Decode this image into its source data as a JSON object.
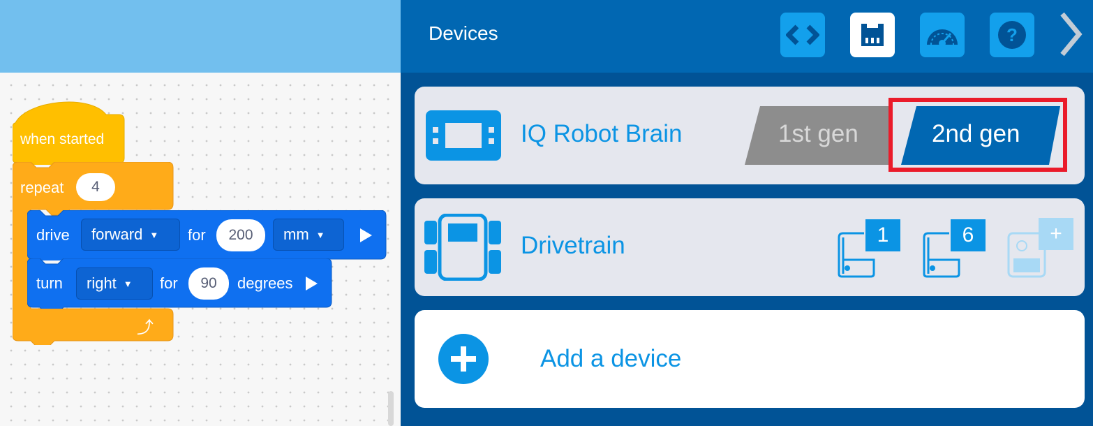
{
  "blocks": {
    "hat_label": "when started",
    "repeat_label": "repeat",
    "repeat_count": "4",
    "drive": {
      "label": "drive",
      "direction": "forward",
      "for_label": "for",
      "distance": "200",
      "unit": "mm"
    },
    "turn": {
      "label": "turn",
      "direction": "right",
      "for_label": "for",
      "angle": "90",
      "unit_label": "degrees"
    }
  },
  "panel": {
    "title": "Devices",
    "header_buttons": [
      "code-view-icon",
      "devices-icon",
      "dashboard-icon",
      "help-icon"
    ],
    "devices": [
      {
        "name": "IQ Robot Brain",
        "options": [
          "1st gen",
          "2nd gen"
        ],
        "selected": "2nd gen"
      },
      {
        "name": "Drivetrain",
        "ports": [
          "1",
          "6"
        ],
        "add_port_symbol": "+"
      }
    ],
    "add_device_label": "Add a device"
  },
  "colors": {
    "hat": "#ffbf00",
    "control": "#ffab19",
    "motion": "#0f70f0",
    "panel": "#015396",
    "accent": "#0b94e4",
    "highlight": "#ea1b2a"
  }
}
